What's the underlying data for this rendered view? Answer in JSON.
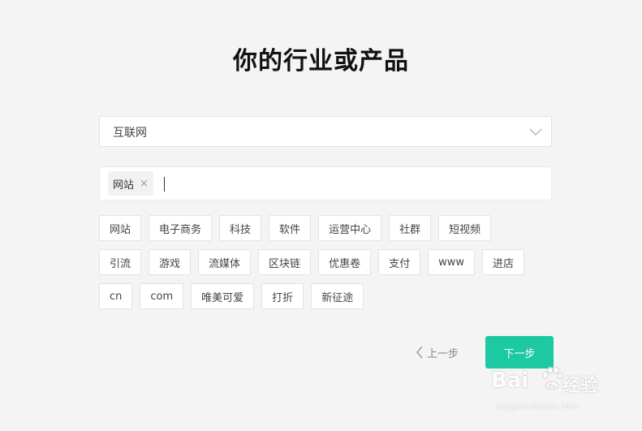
{
  "page": {
    "title": "你的行业或产品"
  },
  "industry_select": {
    "value": "互联网"
  },
  "tag_input": {
    "tags": [
      {
        "label": "网站",
        "remove_symbol": "×"
      }
    ]
  },
  "suggestions": {
    "rows": [
      [
        "网站",
        "电子商务",
        "科技",
        "软件",
        "运营中心",
        "社群",
        "短视频"
      ],
      [
        "引流",
        "游戏",
        "流媒体",
        "区块链",
        "优惠卷",
        "支付",
        "www",
        "进店"
      ],
      [
        "cn",
        "com",
        "唯美可爱",
        "打折",
        "新征途"
      ]
    ]
  },
  "nav": {
    "prev_label": "上一步",
    "next_label": "下一步"
  },
  "watermark": {
    "brand": "Bai",
    "brand_cn": "经验",
    "url": "jingyan.baidu.com"
  },
  "colors": {
    "accent": "#1dc9a2",
    "background": "#f4f4f4"
  },
  "icons": {
    "select_arrow": "chevron-down-icon",
    "prev_arrow": "chevron-left-icon",
    "chip_remove": "close-icon"
  }
}
